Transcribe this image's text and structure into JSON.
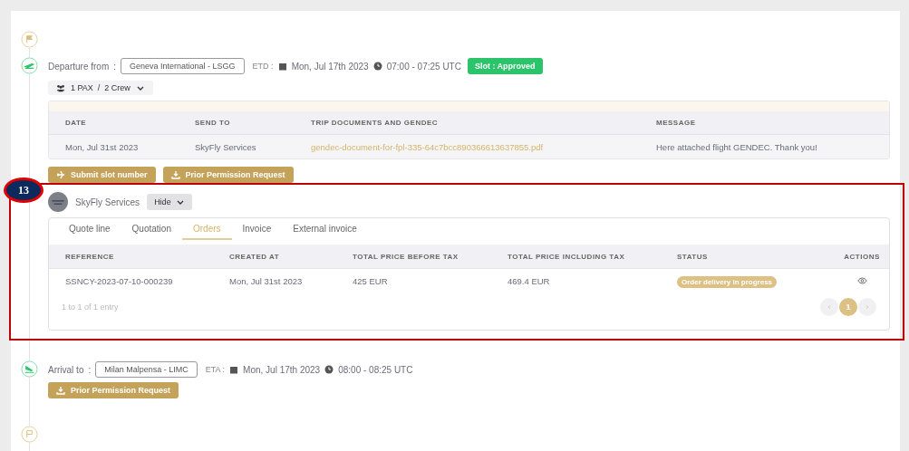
{
  "departure": {
    "label": "Departure from",
    "separator": ":",
    "airport": "Geneva International - LSGG",
    "time_label": "ETD :",
    "date": "Mon, Jul 17th 2023",
    "time": "07:00 - 07:25 UTC",
    "slot_status": "Slot : Approved",
    "crew_button": "1 PAX  /  2 Crew"
  },
  "documents": {
    "columns": [
      "DATE",
      "SEND TO",
      "TRIP DOCUMENTS AND GENDEC",
      "MESSAGE"
    ],
    "rows": [
      {
        "date": "Mon, Jul 31st 2023",
        "send_to": "SkyFly Services",
        "document": "gendec-document-for-fpl-335-64c7bcc890366613637855.pdf",
        "message": "Here attached flight GENDEC. Thank you!"
      }
    ]
  },
  "departure_buttons": [
    {
      "kind": "plane",
      "label": "Submit slot number"
    },
    {
      "kind": "download",
      "label": "Prior Permission Request"
    }
  ],
  "provider": {
    "name": "SkyFly Services",
    "toggle": "Hide"
  },
  "tabs": [
    {
      "label": "Quote line",
      "selected": false
    },
    {
      "label": "Quotation",
      "selected": false
    },
    {
      "label": "Orders",
      "selected": true
    },
    {
      "label": "Invoice",
      "selected": false
    },
    {
      "label": "External invoice",
      "selected": false
    }
  ],
  "orders": {
    "columns": [
      "REFERENCE",
      "CREATED AT",
      "TOTAL PRICE BEFORE TAX",
      "TOTAL PRICE INCLUDING TAX",
      "STATUS",
      "ACTIONS"
    ],
    "rows": [
      {
        "reference": "SSNCY-2023-07-10-000239",
        "created_at": "Mon, Jul 31st 2023",
        "price_before_tax": "425 EUR",
        "price_including_tax": "469.4 EUR",
        "status": "Order delivery in progress"
      }
    ],
    "entries": "1 to 1 of 1 entry",
    "pages": [
      {
        "label": "1",
        "selected": true
      }
    ]
  },
  "arrival": {
    "label": "Arrival to",
    "separator": ":",
    "airport": "Milan Malpensa - LIMC",
    "time_label": "ETA :",
    "date": "Mon, Jul 17th 2023",
    "time": "08:00 - 08:25 UTC"
  },
  "arrival_buttons": [
    {
      "kind": "download",
      "label": "Prior Permission Request"
    }
  ],
  "annotation": {
    "number": "13"
  }
}
